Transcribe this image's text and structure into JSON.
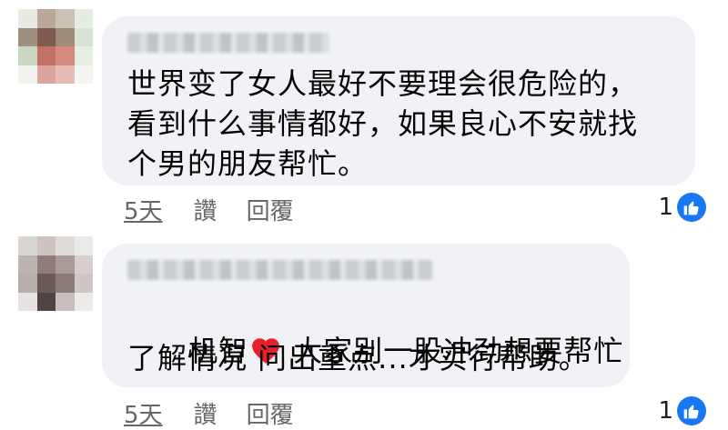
{
  "comments": [
    {
      "lines": [
        "世界变了女人最好不要理会很危险的，",
        "看到什么事情都好，如果良心不安就找",
        "个男的朋友帮忙。"
      ],
      "actions": {
        "time": "5天",
        "like": "讚",
        "reply": "回覆"
      },
      "reaction_count": "1"
    },
    {
      "line1_before": "机智",
      "line1_emoji": "heart-emoji",
      "line1_after": " 大家别一股冲劲想要帮忙",
      "line2": "了解情况 问出重点...才实行帮助。",
      "actions": {
        "time": "5天",
        "like": "讚",
        "reply": "回覆"
      },
      "reaction_count": "1"
    }
  ],
  "colors": {
    "bubble": "#f0f2f5",
    "accent": "#1877f2",
    "meta": "#65676b",
    "heart": "#e8202c"
  }
}
